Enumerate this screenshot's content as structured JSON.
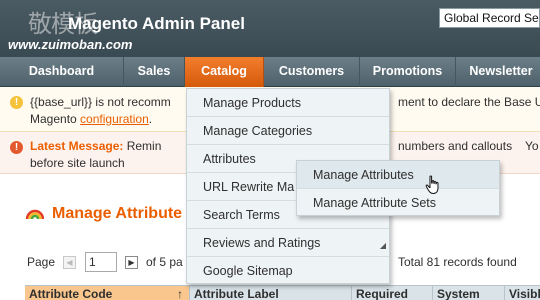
{
  "header": {
    "logo_mark": "敬模板",
    "logo_text": "Magento Admin Panel",
    "watermark_url": "www.zuimoban.com",
    "search_value": "Global Record Search"
  },
  "nav": {
    "items": [
      {
        "label": "Dashboard",
        "active": false
      },
      {
        "label": "Sales",
        "active": false
      },
      {
        "label": "Catalog",
        "active": true
      },
      {
        "label": "Customers",
        "active": false
      },
      {
        "label": "Promotions",
        "active": false
      },
      {
        "label": "Newsletter",
        "active": false
      }
    ]
  },
  "messages": {
    "notice_line1_start": "{{base_url}} is not recomm",
    "notice_line1_end": "ment to declare the Base Ur",
    "notice_line2_start": "Magento ",
    "notice_link": "configuration",
    "notice_line2_end": ".",
    "critical_label": "Latest Message:",
    "critical_line1_start": "Remin",
    "critical_line1_end": "numbers and callouts",
    "critical_right": "Yo",
    "critical_line2": "before site launch"
  },
  "page": {
    "title": "Manage Attribute"
  },
  "pager": {
    "label": "Page",
    "current_page": "1",
    "of_pages": "of 5 pa",
    "total": "Total 81 records found"
  },
  "grid": {
    "columns": [
      {
        "label": "Attribute Code",
        "sort": "↑"
      },
      {
        "label": "Attribute Label"
      },
      {
        "label": "Required"
      },
      {
        "label": "System"
      },
      {
        "label": "Visible"
      }
    ]
  },
  "catalog_menu": {
    "items": [
      "Manage Products",
      "Manage Categories",
      "Attributes",
      "URL Rewrite Ma",
      "Search Terms",
      "Reviews and Ratings",
      "Google Sitemap"
    ]
  },
  "attributes_submenu": {
    "items": [
      "Manage Attributes",
      "Manage Attribute Sets"
    ]
  },
  "colors": {
    "accent": "#eb5e00",
    "header_bg": "#3a4a52",
    "nav_active": "#e86a1c"
  }
}
